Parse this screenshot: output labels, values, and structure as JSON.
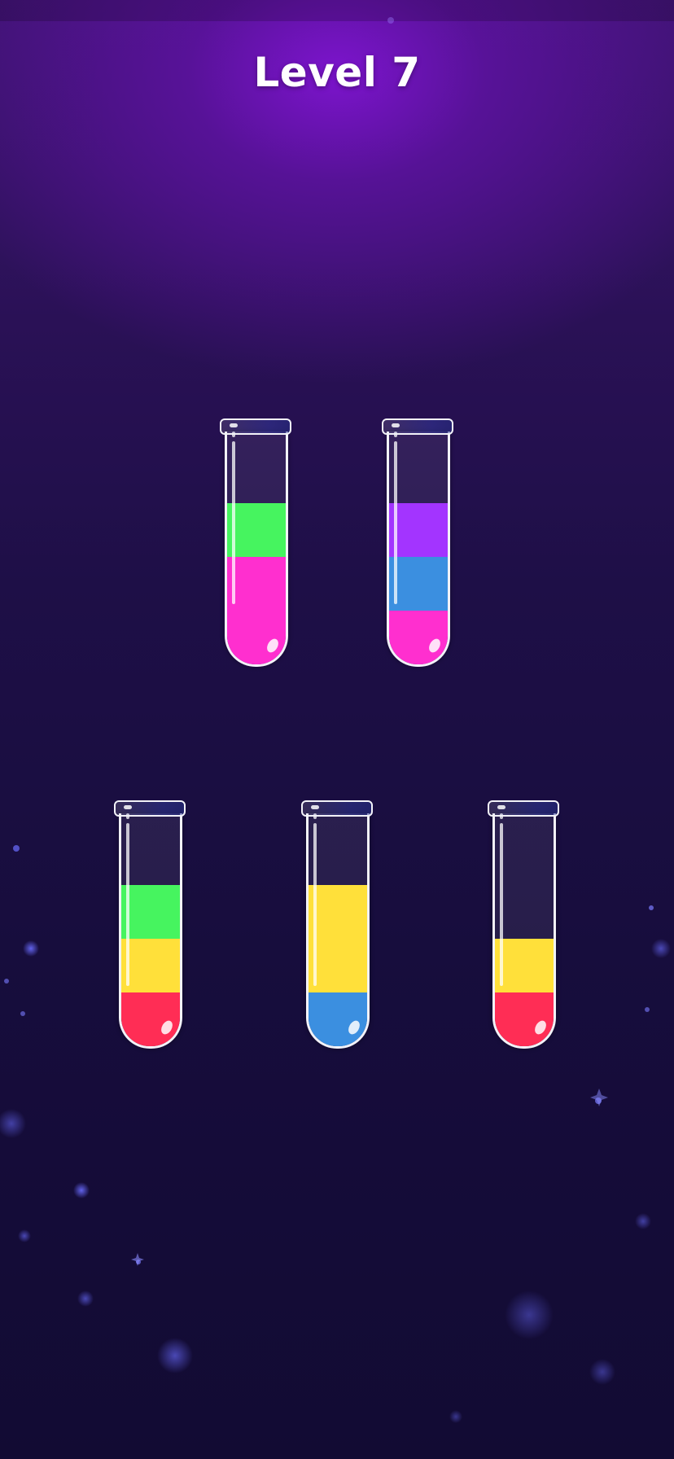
{
  "header": {
    "level_label": "Level 7"
  },
  "colors": {
    "green": "#46f45f",
    "pink": "#ff2fcf",
    "purple": "#a334ff",
    "blue": "#3b8fe0",
    "yellow": "#ffe03a",
    "red": "#ff2d55"
  },
  "tubes": [
    {
      "id": "tube-1",
      "capacity": 4,
      "layers_bottom_to_top": [
        "pink",
        "pink",
        "green"
      ]
    },
    {
      "id": "tube-2",
      "capacity": 4,
      "layers_bottom_to_top": [
        "pink",
        "blue",
        "purple"
      ]
    },
    {
      "id": "tube-3",
      "capacity": 4,
      "layers_bottom_to_top": [
        "red",
        "yellow",
        "green"
      ]
    },
    {
      "id": "tube-4",
      "capacity": 4,
      "layers_bottom_to_top": [
        "blue",
        "yellow",
        "yellow"
      ]
    },
    {
      "id": "tube-5",
      "capacity": 4,
      "layers_bottom_to_top": [
        "red",
        "yellow"
      ]
    }
  ]
}
